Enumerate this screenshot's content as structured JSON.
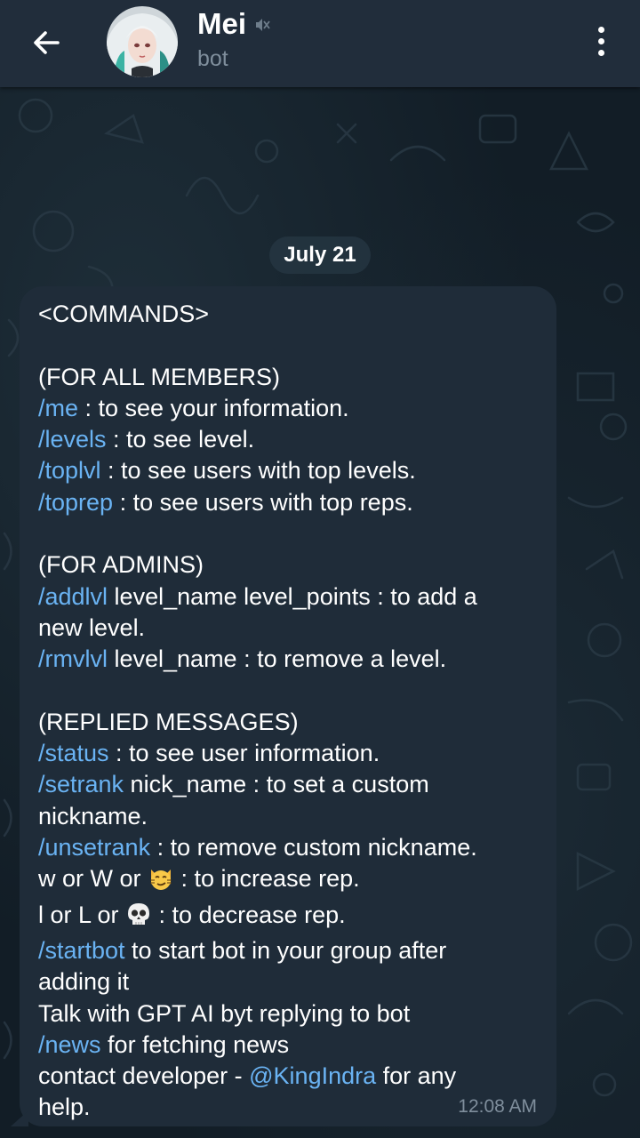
{
  "header": {
    "title": "Mei",
    "subtitle": "bot"
  },
  "chat": {
    "date_label": "July 21",
    "message": {
      "time": "12:08 AM",
      "lines": [
        [
          {
            "t": "<COMMANDS>"
          }
        ],
        [],
        [
          {
            "t": "(FOR ALL MEMBERS)"
          }
        ],
        [
          {
            "t": "/me",
            "cmd": true
          },
          {
            "t": " : to see your information."
          }
        ],
        [
          {
            "t": "/levels",
            "cmd": true
          },
          {
            "t": " : to see level."
          }
        ],
        [
          {
            "t": "/toplvl",
            "cmd": true
          },
          {
            "t": " : to see users with top levels."
          }
        ],
        [
          {
            "t": "/toprep",
            "cmd": true
          },
          {
            "t": " : to see users with top reps."
          }
        ],
        [],
        [
          {
            "t": "(FOR ADMINS)"
          }
        ],
        [
          {
            "t": "/addlvl",
            "cmd": true
          },
          {
            "t": " level_name level_points : to add a"
          }
        ],
        [
          {
            "t": "new level."
          }
        ],
        [
          {
            "t": "/rmvlvl",
            "cmd": true
          },
          {
            "t": " level_name : to remove a level."
          }
        ],
        [],
        [
          {
            "t": "(REPLIED MESSAGES)"
          }
        ],
        [
          {
            "t": "/status",
            "cmd": true
          },
          {
            "t": " : to see user information."
          }
        ],
        [
          {
            "t": "/setrank",
            "cmd": true
          },
          {
            "t": " nick_name : to set a custom"
          }
        ],
        [
          {
            "t": "nickname."
          }
        ],
        [
          {
            "t": "/unsetrank",
            "cmd": true
          },
          {
            "t": " : to remove custom nickname."
          }
        ],
        [
          {
            "t": "w or W or "
          },
          {
            "emoji": "smirk-cat-emoji"
          },
          {
            "t": " : to increase rep."
          }
        ],
        [
          {
            "t": "l or L or "
          },
          {
            "emoji": "skull-emoji"
          },
          {
            "t": " : to decrease rep."
          }
        ],
        [
          {
            "t": "/startbot",
            "cmd": true
          },
          {
            "t": " to start bot in your group after"
          }
        ],
        [
          {
            "t": "adding it"
          }
        ],
        [
          {
            "t": "Talk with GPT AI byt replying to bot"
          }
        ],
        [
          {
            "t": "/news",
            "cmd": true
          },
          {
            "t": " for fetching news"
          }
        ],
        [
          {
            "t": "contact developer - "
          },
          {
            "t": "@KingIndra",
            "cmd": true
          },
          {
            "t": " for any"
          }
        ],
        [
          {
            "t": "help."
          }
        ]
      ]
    }
  },
  "colors": {
    "header_bg": "#212d3b",
    "bubble_bg": "#1f2c39",
    "link": "#6ab3f3",
    "muted_text": "#7f8e9c"
  }
}
